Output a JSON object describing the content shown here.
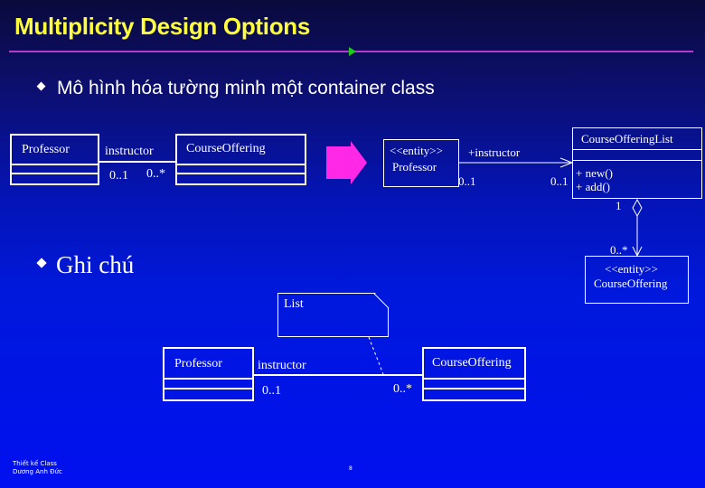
{
  "slide": {
    "title": "Multiplicity Design Options",
    "bullets": [
      "Mô hình hóa tường minh một container class",
      "Ghi chú"
    ],
    "footer": {
      "line1": "Thiết kế Class",
      "line2": "Dương Anh Đức"
    },
    "page_number": "8",
    "colors": {
      "title": "#ffff3c",
      "rule": "#b43cc8",
      "rule_marker": "#1ec81e",
      "arrow": "#ff28e6",
      "background_bottom": "#0010f0",
      "background_top": "#0a0a3c"
    }
  },
  "diagram_original": {
    "class_left": "Professor",
    "class_right": "CourseOffering",
    "role": "instructor",
    "mult_left": "0..1",
    "mult_right": "0..*"
  },
  "diagram_container": {
    "professor": {
      "stereotype": "<<entity>>",
      "name": "Professor"
    },
    "role": "+instructor",
    "mult_professor": "0..1",
    "mult_list": "0..1",
    "list_class": {
      "name": "CourseOfferingList",
      "operations": [
        "+ new()",
        "+ add()"
      ]
    },
    "aggregation_mult_whole": "1",
    "aggregation_mult_part": "0..*",
    "course_offering": {
      "stereotype": "<<entity>>",
      "name": "CourseOffering"
    }
  },
  "diagram_note": {
    "note_text": "List",
    "class_left": "Professor",
    "class_right": "CourseOffering",
    "role": "instructor",
    "mult_left": "0..1",
    "mult_right": "0..*"
  },
  "icons": {
    "transform_arrow": "right-arrow-icon",
    "bullet": "diamond-bullet-icon"
  }
}
